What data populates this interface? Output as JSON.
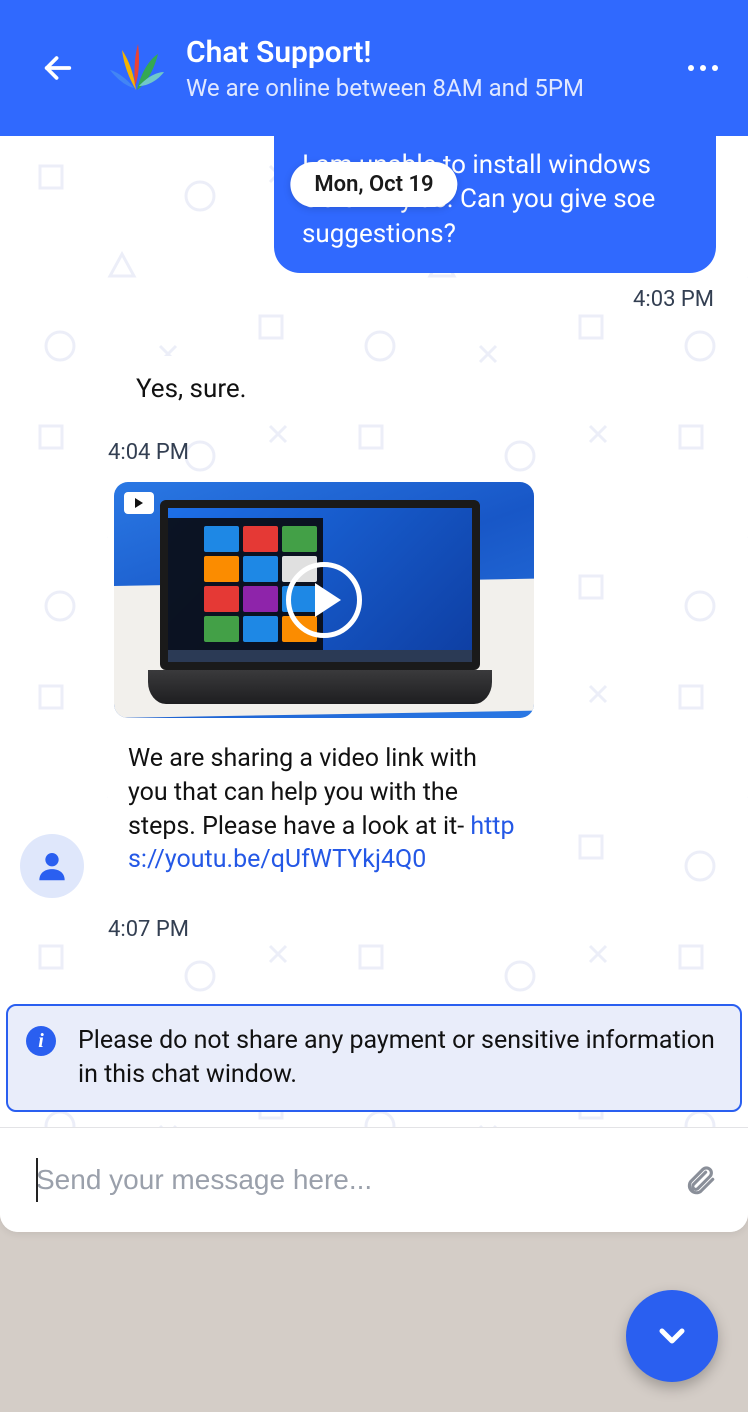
{
  "header": {
    "title": "Chat Support!",
    "subtitle": "We are online between 8AM and 5PM"
  },
  "date_label": "Mon, Oct 19",
  "messages": {
    "outgoing": {
      "text": "I am unable to install windows OS on my ac. Can you give soe suggestions?",
      "time": "4:03 PM"
    },
    "incoming1": {
      "text": "Yes, sure.",
      "time": "4:04 PM"
    },
    "incoming2": {
      "text": "We are sharing a video link with you that can help you with the steps. Please have a look at it-",
      "link": "https://youtu.be/qUfWTYkj4Q0",
      "time": "4:07 PM"
    }
  },
  "banner": {
    "text": "Please do not share any payment or sensitive information in this chat window."
  },
  "composer": {
    "placeholder": "Send your message here..."
  }
}
